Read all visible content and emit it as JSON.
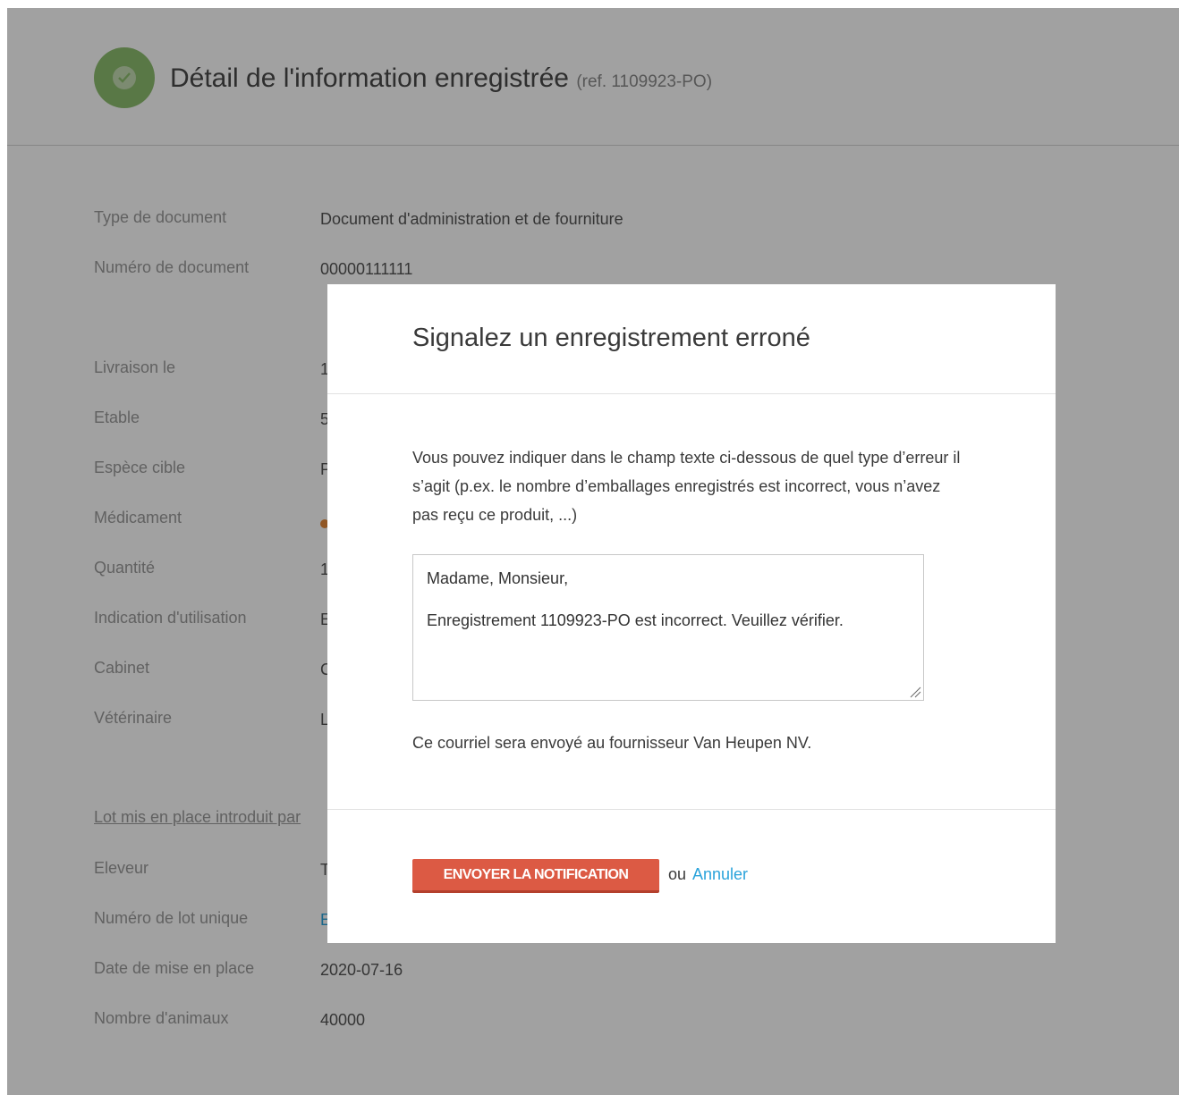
{
  "header": {
    "title": "Détail de l'information enregistrée",
    "ref": "(ref. 1109923-PO)"
  },
  "details": [
    {
      "label": "Type de document",
      "value": "Document d'administration et de fourniture"
    },
    {
      "label": "Numéro de document",
      "value": "00000111111"
    },
    {
      "label": "Livraison le",
      "value": "1"
    },
    {
      "label": "Etable",
      "value": "5"
    },
    {
      "label": "Espèce cible",
      "value": "P"
    },
    {
      "label": "Médicament",
      "value": ""
    },
    {
      "label": "Quantité",
      "value": "1"
    },
    {
      "label": "Indication d'utilisation",
      "value": "E"
    },
    {
      "label": "Cabinet",
      "value": "C"
    },
    {
      "label": "Vétérinaire",
      "value": "L"
    }
  ],
  "lot_section": {
    "title": "Lot mis en place introduit par",
    "items": [
      {
        "label": "Eleveur",
        "value": "T"
      },
      {
        "label": "Numéro de lot unique",
        "value": "E"
      },
      {
        "label": "Date de mise en place",
        "value": "2020-07-16"
      },
      {
        "label": "Nombre d'animaux",
        "value": "40000"
      }
    ]
  },
  "modal": {
    "title": "Signalez un enregistrement erroné",
    "intro": "Vous pouvez indiquer dans le champ texte ci-dessous de quel type d’erreur il s’agit (p.ex. le nombre d’emballages enregistrés est incorrect, vous n’avez pas reçu ce produit, ...)",
    "textarea_line1": "Madame, Monsieur,",
    "textarea_line2": "Enregistrement 1109923-PO est incorrect. Veuillez vérifier.",
    "note": "Ce courriel sera envoyé au fournisseur Van Heupen NV.",
    "send_label": "ENVOYER LA NOTIFICATION",
    "or_text": "ou",
    "cancel_label": "Annuler"
  },
  "colors": {
    "accent_red": "#dc5a44",
    "link_blue": "#2aa3db",
    "success_green": "#8ebe6f"
  }
}
